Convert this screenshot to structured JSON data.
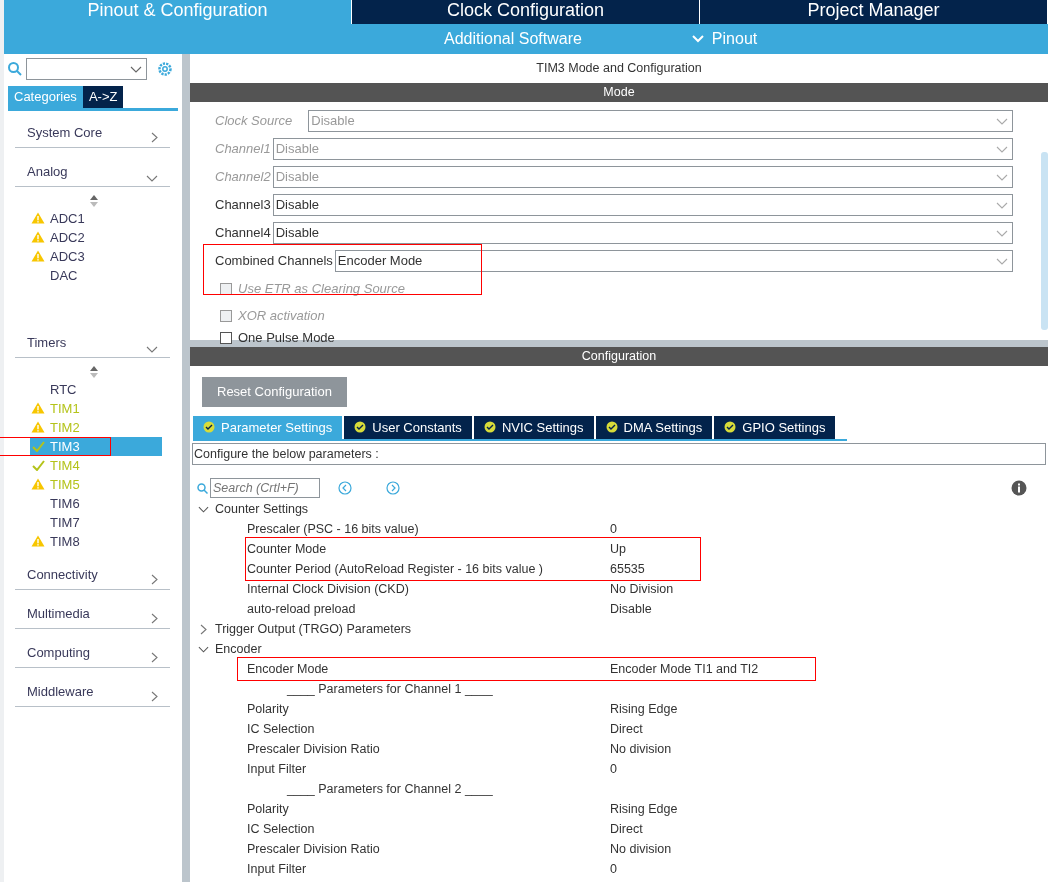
{
  "top_tabs": [
    {
      "label": "Pinout & Configuration",
      "selected": true
    },
    {
      "label": "Clock Configuration",
      "selected": false
    },
    {
      "label": "Project Manager",
      "selected": false
    }
  ],
  "sub_menu": [
    {
      "label": "Additional Software",
      "dropdown": false
    },
    {
      "label": "Pinout",
      "dropdown": true
    }
  ],
  "sidebar": {
    "view_tabs": [
      {
        "label": "Categories",
        "selected": true
      },
      {
        "label": "A->Z",
        "selected": false
      }
    ],
    "categories": [
      {
        "label": "System Core",
        "expanded": false
      },
      {
        "label": "Analog",
        "expanded": true,
        "children": [
          {
            "label": "ADC1",
            "kind": "warning",
            "configured": false,
            "selected": false,
            "annotated": false
          },
          {
            "label": "ADC2",
            "kind": "warning",
            "configured": false,
            "selected": false,
            "annotated": false
          },
          {
            "label": "ADC3",
            "kind": "warning",
            "configured": false,
            "selected": false,
            "annotated": false
          },
          {
            "label": "DAC",
            "kind": "plain",
            "configured": false,
            "selected": false,
            "annotated": false
          }
        ]
      },
      {
        "label": "Timers",
        "expanded": true,
        "children": [
          {
            "label": "RTC",
            "kind": "plain",
            "configured": false,
            "selected": false,
            "annotated": false
          },
          {
            "label": "TIM1",
            "kind": "warning",
            "configured": true,
            "selected": false,
            "annotated": false
          },
          {
            "label": "TIM2",
            "kind": "warning",
            "configured": true,
            "selected": false,
            "annotated": false
          },
          {
            "label": "TIM3",
            "kind": "ok",
            "configured": true,
            "selected": true,
            "annotated": true
          },
          {
            "label": "TIM4",
            "kind": "ok",
            "configured": true,
            "selected": false,
            "annotated": false
          },
          {
            "label": "TIM5",
            "kind": "warning",
            "configured": true,
            "selected": false,
            "annotated": false
          },
          {
            "label": "TIM6",
            "kind": "plain",
            "configured": false,
            "selected": false,
            "annotated": false
          },
          {
            "label": "TIM7",
            "kind": "plain",
            "configured": false,
            "selected": false,
            "annotated": false
          },
          {
            "label": "TIM8",
            "kind": "warning",
            "configured": false,
            "selected": false,
            "annotated": false
          }
        ]
      },
      {
        "label": "Connectivity",
        "expanded": false
      },
      {
        "label": "Multimedia",
        "expanded": false
      },
      {
        "label": "Computing",
        "expanded": false
      },
      {
        "label": "Middleware",
        "expanded": false
      }
    ]
  },
  "panel_title": "TIM3 Mode and Configuration",
  "mode": {
    "title": "Mode",
    "fields": [
      {
        "kind": "select",
        "label": "Clock Source",
        "value": "Disable",
        "enabled": false,
        "annotated": false
      },
      {
        "kind": "select",
        "label": "Channel1",
        "value": "Disable",
        "enabled": false,
        "annotated": false
      },
      {
        "kind": "select",
        "label": "Channel2",
        "value": "Disable",
        "enabled": false,
        "annotated": false
      },
      {
        "kind": "select",
        "label": "Channel3",
        "value": "Disable",
        "enabled": true,
        "annotated": false
      },
      {
        "kind": "select",
        "label": "Channel4",
        "value": "Disable",
        "enabled": true,
        "annotated": false
      },
      {
        "kind": "select",
        "label": "Combined Channels",
        "value": "Encoder Mode",
        "enabled": true,
        "annotated": true
      },
      {
        "kind": "checkbox",
        "label": "Use ETR as Clearing Source",
        "checked": false,
        "enabled": false
      },
      {
        "kind": "checkbox",
        "label": "XOR activation",
        "checked": false,
        "enabled": false
      },
      {
        "kind": "checkbox",
        "label": "One Pulse Mode",
        "checked": false,
        "enabled": true
      }
    ]
  },
  "configuration": {
    "title": "Configuration",
    "reset_button": "Reset Configuration",
    "tabs": [
      {
        "label": "Parameter Settings",
        "selected": true
      },
      {
        "label": "User Constants",
        "selected": false
      },
      {
        "label": "NVIC Settings",
        "selected": false
      },
      {
        "label": "DMA Settings",
        "selected": false
      },
      {
        "label": "GPIO Settings",
        "selected": false
      }
    ],
    "hint": "Configure the below parameters :",
    "search": {
      "placeholder": "Search (Crtl+F)"
    },
    "groups": [
      {
        "label": "Counter Settings",
        "expanded": true,
        "children": [
          {
            "kind": "param",
            "name": "Prescaler (PSC - 16 bits value)",
            "value": "0",
            "annotated": false
          },
          {
            "kind": "param",
            "name": "Counter Mode",
            "value": "Up",
            "annotated": true
          },
          {
            "kind": "param",
            "name": "Counter Period (AutoReload Register - 16 bits value )",
            "value": "65535",
            "annotated": true
          },
          {
            "kind": "param",
            "name": "Internal Clock Division (CKD)",
            "value": "No Division",
            "annotated": false
          },
          {
            "kind": "param",
            "name": "auto-reload preload",
            "value": "Disable",
            "annotated": false
          }
        ]
      },
      {
        "label": "Trigger Output (TRGO) Parameters",
        "expanded": false
      },
      {
        "label": "Encoder",
        "expanded": true,
        "children": [
          {
            "kind": "param",
            "name": "Encoder Mode",
            "value": "Encoder Mode TI1 and TI2",
            "annotated": true
          },
          {
            "kind": "subheader",
            "name": "____ Parameters for Channel 1 ____",
            "annotated": false
          },
          {
            "kind": "param",
            "name": "Polarity",
            "value": "Rising Edge",
            "annotated": false
          },
          {
            "kind": "param",
            "name": "IC Selection",
            "value": "Direct",
            "annotated": false
          },
          {
            "kind": "param",
            "name": "Prescaler Division Ratio",
            "value": "No division",
            "annotated": false
          },
          {
            "kind": "param",
            "name": "Input Filter",
            "value": "0",
            "annotated": false
          },
          {
            "kind": "subheader",
            "name": "____ Parameters for Channel 2 ____",
            "annotated": false
          },
          {
            "kind": "param",
            "name": "Polarity",
            "value": "Rising Edge",
            "annotated": false
          },
          {
            "kind": "param",
            "name": "IC Selection",
            "value": "Direct",
            "annotated": false
          },
          {
            "kind": "param",
            "name": "Prescaler Division Ratio",
            "value": "No division",
            "annotated": false
          },
          {
            "kind": "param",
            "name": "Input Filter",
            "value": "0",
            "annotated": false
          }
        ]
      }
    ]
  }
}
